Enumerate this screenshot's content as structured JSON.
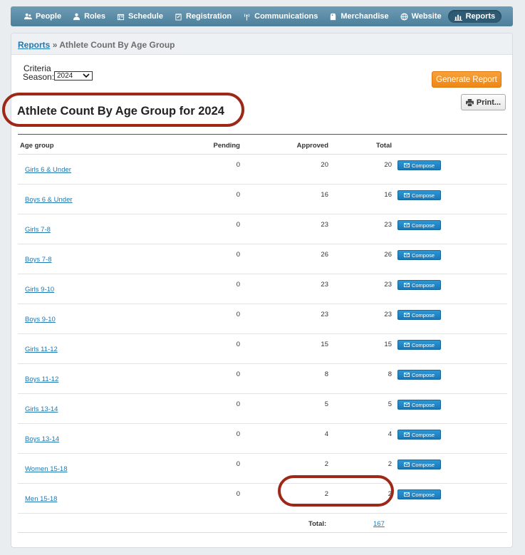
{
  "nav": {
    "items": [
      {
        "label": "People",
        "icon": "people-icon"
      },
      {
        "label": "Roles",
        "icon": "roles-icon"
      },
      {
        "label": "Schedule",
        "icon": "calendar-icon"
      },
      {
        "label": "Registration",
        "icon": "clipboard-check-icon"
      },
      {
        "label": "Communications",
        "icon": "broadcast-icon"
      },
      {
        "label": "Merchandise",
        "icon": "tag-icon"
      },
      {
        "label": "Website",
        "icon": "globe-icon"
      },
      {
        "label": "Reports",
        "icon": "bar-chart-icon",
        "active": true
      }
    ]
  },
  "breadcrumb": {
    "parent": "Reports",
    "separator": "»",
    "current": "Athlete Count By Age Group"
  },
  "criteria": {
    "label": "Criteria",
    "season_label": "Season:",
    "season_value": "2024"
  },
  "buttons": {
    "generate": "Generate Report",
    "print": "Print..."
  },
  "report": {
    "title": "Athlete Count By Age Group for 2024"
  },
  "table": {
    "headers": {
      "age_group": "Age group",
      "pending": "Pending",
      "approved": "Approved",
      "total": "Total"
    },
    "compose_label": "Compose",
    "rows": [
      {
        "group": "Girls 6 & Under",
        "pending": "0",
        "approved": "20",
        "total": "20"
      },
      {
        "group": "Boys 6 & Under",
        "pending": "0",
        "approved": "16",
        "total": "16"
      },
      {
        "group": "Girls 7-8",
        "pending": "0",
        "approved": "23",
        "total": "23"
      },
      {
        "group": "Boys 7-8",
        "pending": "0",
        "approved": "26",
        "total": "26"
      },
      {
        "group": "Girls 9-10",
        "pending": "0",
        "approved": "23",
        "total": "23"
      },
      {
        "group": "Boys 9-10",
        "pending": "0",
        "approved": "23",
        "total": "23"
      },
      {
        "group": "Girls 11-12",
        "pending": "0",
        "approved": "15",
        "total": "15"
      },
      {
        "group": "Boys 11-12",
        "pending": "0",
        "approved": "8",
        "total": "8"
      },
      {
        "group": "Girls 13-14",
        "pending": "0",
        "approved": "5",
        "total": "5"
      },
      {
        "group": "Boys 13-14",
        "pending": "0",
        "approved": "4",
        "total": "4"
      },
      {
        "group": "Women 15-18",
        "pending": "0",
        "approved": "2",
        "total": "2"
      },
      {
        "group": "Men 15-18",
        "pending": "0",
        "approved": "2",
        "total": "2"
      }
    ],
    "footer": {
      "label": "Total:",
      "value": "167"
    }
  },
  "colors": {
    "nav_bg": "#5b8ba6",
    "link": "#1e78b4",
    "generate_button": "#f39325",
    "compose_button": "#2389c6",
    "highlight_annotation": "#9e2818"
  }
}
